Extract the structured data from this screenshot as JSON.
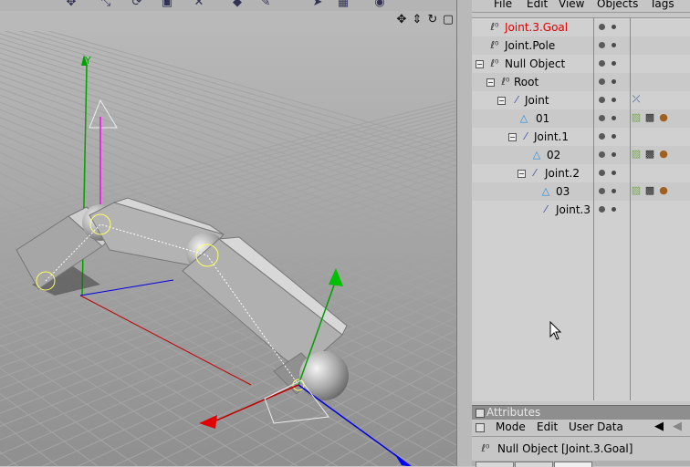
{
  "viewport": {
    "axis_label": "Y"
  },
  "object_manager": {
    "menu": [
      "File",
      "Edit",
      "View",
      "Objects",
      "Tags"
    ],
    "objects": [
      {
        "name": "Joint.3.Goal",
        "highlight": true,
        "icon": "null-icon"
      },
      {
        "name": "Joint.Pole",
        "highlight": false,
        "icon": "null-icon"
      },
      {
        "name": "Null Object",
        "highlight": false,
        "icon": "null-icon"
      },
      {
        "name": "Root",
        "highlight": false,
        "icon": "null-icon"
      },
      {
        "name": "Joint",
        "highlight": false,
        "icon": "joint-icon"
      },
      {
        "name": "01",
        "highlight": false,
        "icon": "polygon-icon"
      },
      {
        "name": "Joint.1",
        "highlight": false,
        "icon": "joint-icon"
      },
      {
        "name": "02",
        "highlight": false,
        "icon": "polygon-icon"
      },
      {
        "name": "Joint.2",
        "highlight": false,
        "icon": "joint-icon"
      },
      {
        "name": "03",
        "highlight": false,
        "icon": "polygon-icon"
      },
      {
        "name": "Joint.3",
        "highlight": false,
        "icon": "joint-icon"
      }
    ]
  },
  "attributes": {
    "header": "Attributes",
    "menu": [
      "Mode",
      "Edit",
      "User Data"
    ],
    "title": "Null Object [Joint.3.Goal]"
  },
  "colors": {
    "selected_text": "#e00000",
    "axis_x": "#c00000",
    "axis_y": "#00a000",
    "axis_z": "#0000e0"
  }
}
